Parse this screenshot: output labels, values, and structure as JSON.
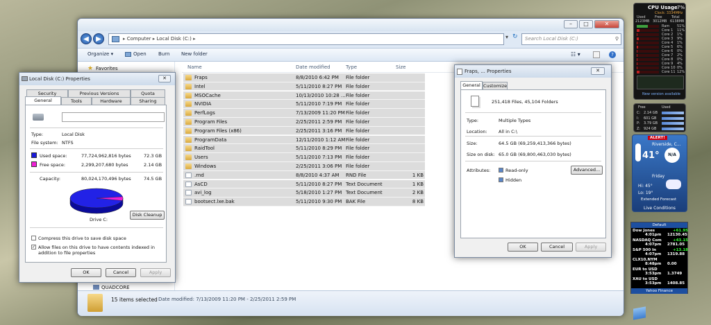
{
  "explorer": {
    "address": [
      "Computer",
      "Local Disk (C:)"
    ],
    "search_placeholder": "Search Local Disk (C:)",
    "toolbar": [
      "Organize ▾",
      "Open",
      "Burn",
      "New folder"
    ],
    "nav": {
      "favorites": "Favorites",
      "quadcore": "QUADCORE"
    },
    "columns": [
      "Name",
      "Date modified",
      "Type",
      "Size"
    ],
    "rows": [
      {
        "name": "Fraps",
        "date": "8/8/2010 6:42 PM",
        "type": "File folder",
        "size": "",
        "kind": "folder"
      },
      {
        "name": "Intel",
        "date": "5/11/2010 8:27 PM",
        "type": "File folder",
        "size": "",
        "kind": "folder"
      },
      {
        "name": "MSOCache",
        "date": "10/13/2010 10:28 ...",
        "type": "File folder",
        "size": "",
        "kind": "folder"
      },
      {
        "name": "NVIDIA",
        "date": "5/11/2010 7:19 PM",
        "type": "File folder",
        "size": "",
        "kind": "folder"
      },
      {
        "name": "PerfLogs",
        "date": "7/13/2009 11:20 PM",
        "type": "File folder",
        "size": "",
        "kind": "folder"
      },
      {
        "name": "Program Files",
        "date": "2/25/2011 2:59 PM",
        "type": "File folder",
        "size": "",
        "kind": "folder"
      },
      {
        "name": "Program Files (x86)",
        "date": "2/25/2011 3:16 PM",
        "type": "File folder",
        "size": "",
        "kind": "folder"
      },
      {
        "name": "ProgramData",
        "date": "12/11/2010 1:12 AM",
        "type": "File folder",
        "size": "",
        "kind": "folder"
      },
      {
        "name": "RaidTool",
        "date": "5/11/2010 8:29 PM",
        "type": "File folder",
        "size": "",
        "kind": "folder"
      },
      {
        "name": "Users",
        "date": "5/11/2010 7:13 PM",
        "type": "File folder",
        "size": "",
        "kind": "folder"
      },
      {
        "name": "Windows",
        "date": "2/25/2011 3:06 PM",
        "type": "File folder",
        "size": "",
        "kind": "folder"
      },
      {
        "name": ".rnd",
        "date": "8/8/2010 4:37 AM",
        "type": "RND File",
        "size": "1 KB",
        "kind": "file"
      },
      {
        "name": "AsCD",
        "date": "5/11/2010 8:27 PM",
        "type": "Text Document",
        "size": "1 KB",
        "kind": "file"
      },
      {
        "name": "avi_log",
        "date": "5/18/2010 1:27 PM",
        "type": "Text Document",
        "size": "2 KB",
        "kind": "file"
      },
      {
        "name": "bootsect.lxe.bak",
        "date": "5/11/2010 9:30 PM",
        "type": "BAK File",
        "size": "8 KB",
        "kind": "file"
      }
    ],
    "status": {
      "count": "15 items selected",
      "dates": "Date modified: 7/13/2009 11:20 PM - 2/25/2011 2:59 PM"
    }
  },
  "disk_dialog": {
    "title": "Local Disk (C:) Properties",
    "tabs_top": [
      "Security",
      "Previous Versions",
      "Quota"
    ],
    "tabs_bottom": [
      "General",
      "Tools",
      "Hardware",
      "Sharing"
    ],
    "type_label": "Type:",
    "type_value": "Local Disk",
    "fs_label": "File system:",
    "fs_value": "NTFS",
    "used_label": "Used space:",
    "used_bytes": "77,724,962,816 bytes",
    "used_gb": "72.3 GB",
    "free_label": "Free space:",
    "free_bytes": "2,299,207,680 bytes",
    "free_gb": "2.14 GB",
    "cap_label": "Capacity:",
    "cap_bytes": "80,024,170,496 bytes",
    "cap_gb": "74.5 GB",
    "drive_label": "Drive C:",
    "cleanup": "Disk Cleanup",
    "compress": "Compress this drive to save disk space",
    "index": "Allow files on this drive to have contents indexed in addition to file properties",
    "ok": "OK",
    "cancel": "Cancel",
    "apply": "Apply",
    "used_fraction": 0.971
  },
  "fraps_dialog": {
    "title": "Fraps, ... Properties",
    "tabs": [
      "General",
      "Customize"
    ],
    "summary": "251,418 Files, 45,104 Folders",
    "type_label": "Type:",
    "type_value": "Multiple Types",
    "loc_label": "Location:",
    "loc_value": "All in C:\\",
    "size_label": "Size:",
    "size_value": "64.5 GB (69,259,413,366 bytes)",
    "disk_label": "Size on disk:",
    "disk_value": "65.0 GB (69,800,463,030 bytes)",
    "attr_label": "Attributes:",
    "readonly": "Read-only",
    "hidden": "Hidden",
    "advanced": "Advanced...",
    "ok": "OK",
    "cancel": "Cancel",
    "apply": "Apply"
  },
  "cpu": {
    "title": "CPU Usage",
    "pct": "7%",
    "clock": "Clock: 3334MHz",
    "used": "Used",
    "free": "Free",
    "total": "Total",
    "ram_used": "2123MB",
    "ram_free": "3012MB",
    "ram_total": "6138MB",
    "cores": [
      {
        "n": "Ram",
        "v": "51%"
      },
      {
        "n": "Core 1",
        "v": "11%"
      },
      {
        "n": "Core 2",
        "v": "1%"
      },
      {
        "n": "Core 3",
        "v": "9%"
      },
      {
        "n": "Core 4",
        "v": "1%"
      },
      {
        "n": "Core 5",
        "v": "6%"
      },
      {
        "n": "Core 6",
        "v": "0%"
      },
      {
        "n": "Core 7",
        "v": "2%"
      },
      {
        "n": "Core 8",
        "v": "0%"
      },
      {
        "n": "Core 9",
        "v": "4%"
      },
      {
        "n": "Core 10",
        "v": "0%"
      },
      {
        "n": "Core 11",
        "v": "12%"
      }
    ],
    "note": "New version available"
  },
  "drives": {
    "free": "Free",
    "used": "Used",
    "items": [
      {
        "d": "C:",
        "v": "2.14 GB"
      },
      {
        "d": "I:",
        "v": "601 GB"
      },
      {
        "d": "P:",
        "v": "3.79 GB"
      },
      {
        "d": "Z:",
        "v": "924 GB"
      }
    ]
  },
  "weather": {
    "alert": "ALERT!",
    "city": "Riverside, C...",
    "temp": "41°",
    "cond": "N/A",
    "day": "Friday",
    "hi": "Hi: 45°",
    "lo": "Lo: 19°",
    "ext": "Extended Forecast",
    "live": "Live Conditions"
  },
  "stocks": {
    "header": "Default",
    "footer": "Yahoo Finance",
    "rows": [
      {
        "name": "Dow Jones",
        "chg": "+61.95",
        "time": "4:01pm",
        "val": "12130.45"
      },
      {
        "name": "NASDAQ Com",
        "chg": "+43.15",
        "time": "4:07pm",
        "val": "2781.05"
      },
      {
        "name": "S&P 500 In",
        "chg": "+13.18",
        "time": "4:07pm",
        "val": "1319.88"
      },
      {
        "name": "CLX10.NYM",
        "chg": "",
        "time": "8:48pm",
        "val": "0.00"
      },
      {
        "name": "EUR to USD",
        "chg": "",
        "time": "3:53pm",
        "val": "1.3749"
      },
      {
        "name": "XAU to USD",
        "chg": "",
        "time": "3:53pm",
        "val": "1408.85"
      }
    ]
  }
}
